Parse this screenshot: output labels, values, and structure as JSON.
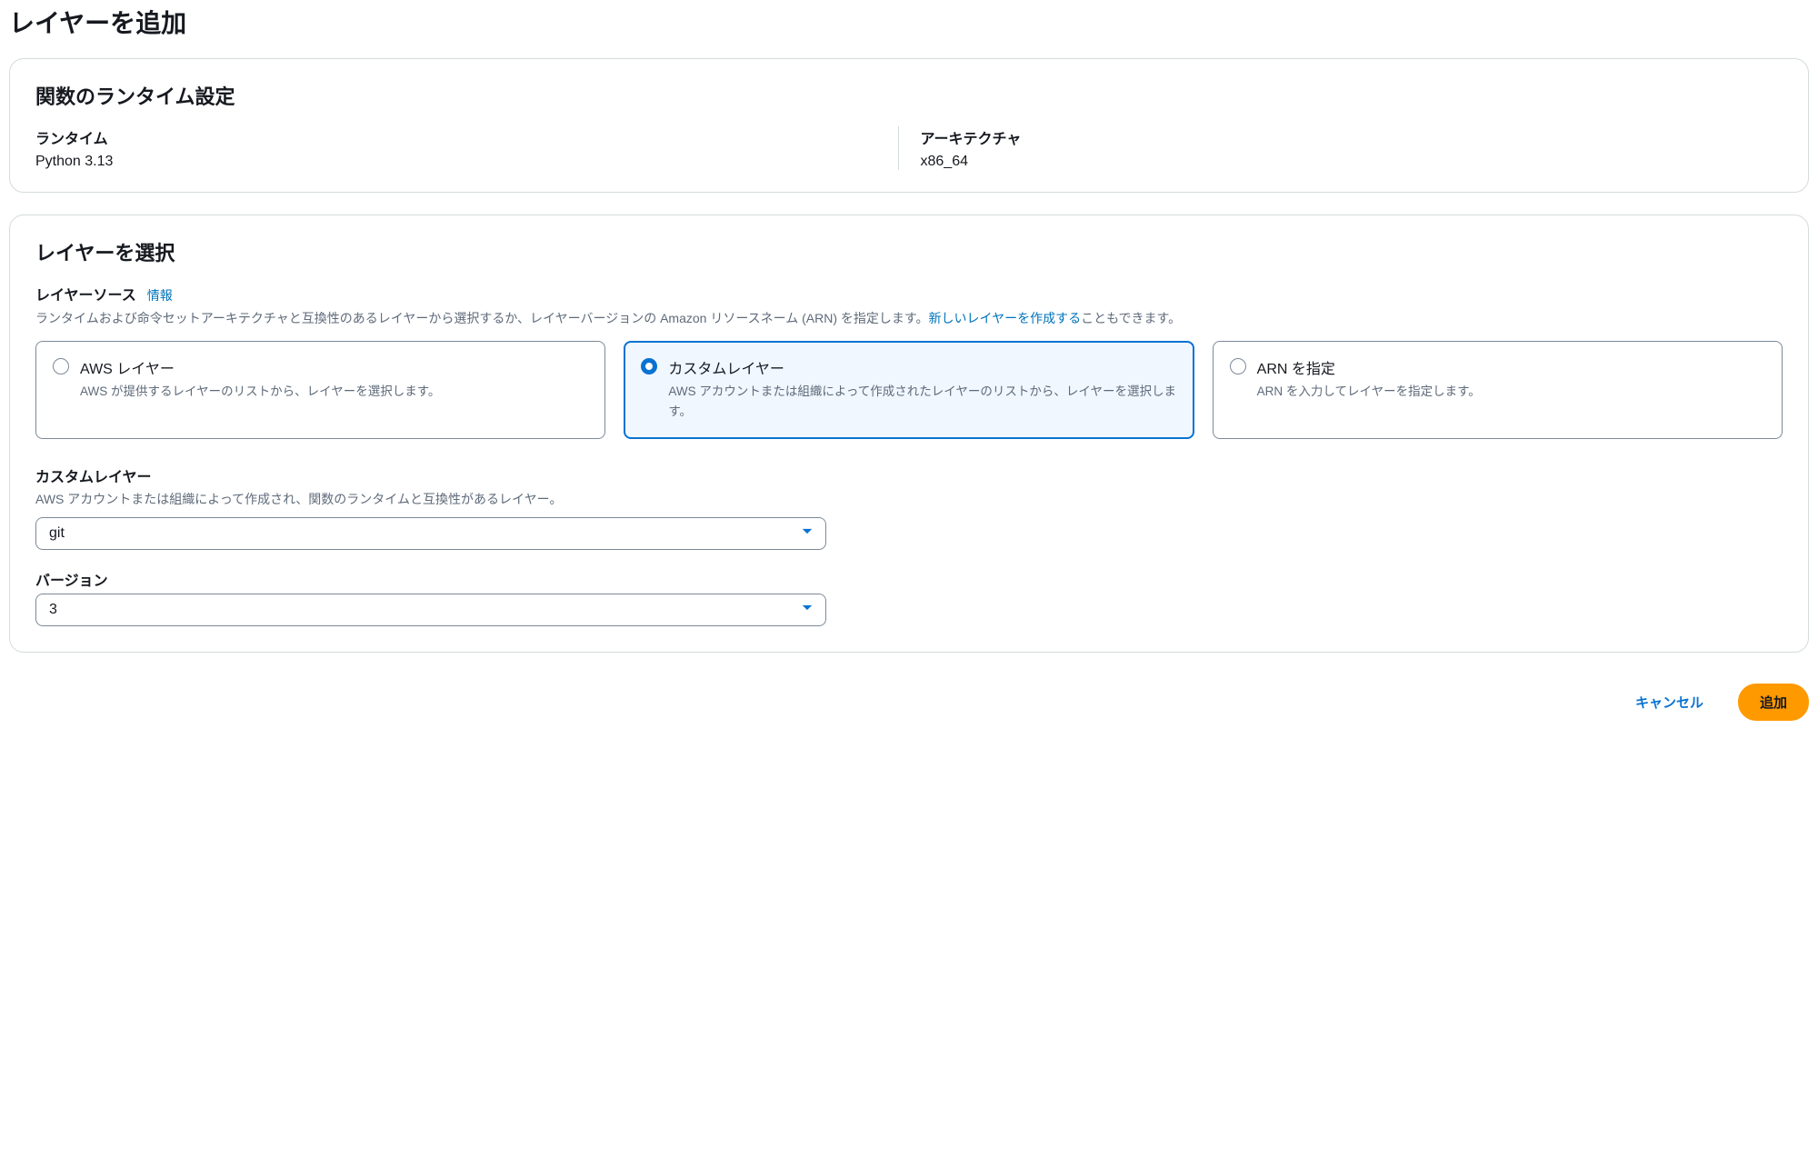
{
  "page_title": "レイヤーを追加",
  "runtime_panel": {
    "title": "関数のランタイム設定",
    "runtime_label": "ランタイム",
    "runtime_value": "Python 3.13",
    "arch_label": "アーキテクチャ",
    "arch_value": "x86_64"
  },
  "layer_panel": {
    "title": "レイヤーを選択",
    "source_label": "レイヤーソース",
    "info_link": "情報",
    "description_prefix": "ランタイムおよび命令セットアーキテクチャと互換性のあるレイヤーから選択するか、レイヤーバージョンの Amazon リソースネーム (ARN) を指定します。",
    "create_link": "新しいレイヤーを作成する",
    "description_suffix": "こともできます。",
    "options": {
      "aws": {
        "title": "AWS レイヤー",
        "desc": "AWS が提供するレイヤーのリストから、レイヤーを選択します。"
      },
      "custom": {
        "title": "カスタムレイヤー",
        "desc": "AWS アカウントまたは組織によって作成されたレイヤーのリストから、レイヤーを選択します。"
      },
      "arn": {
        "title": "ARN を指定",
        "desc": "ARN を入力してレイヤーを指定します。"
      }
    },
    "custom_layer": {
      "label": "カスタムレイヤー",
      "help": "AWS アカウントまたは組織によって作成され、関数のランタイムと互換性があるレイヤー。",
      "value": "git"
    },
    "version": {
      "label": "バージョン",
      "value": "3"
    }
  },
  "actions": {
    "cancel": "キャンセル",
    "add": "追加"
  }
}
